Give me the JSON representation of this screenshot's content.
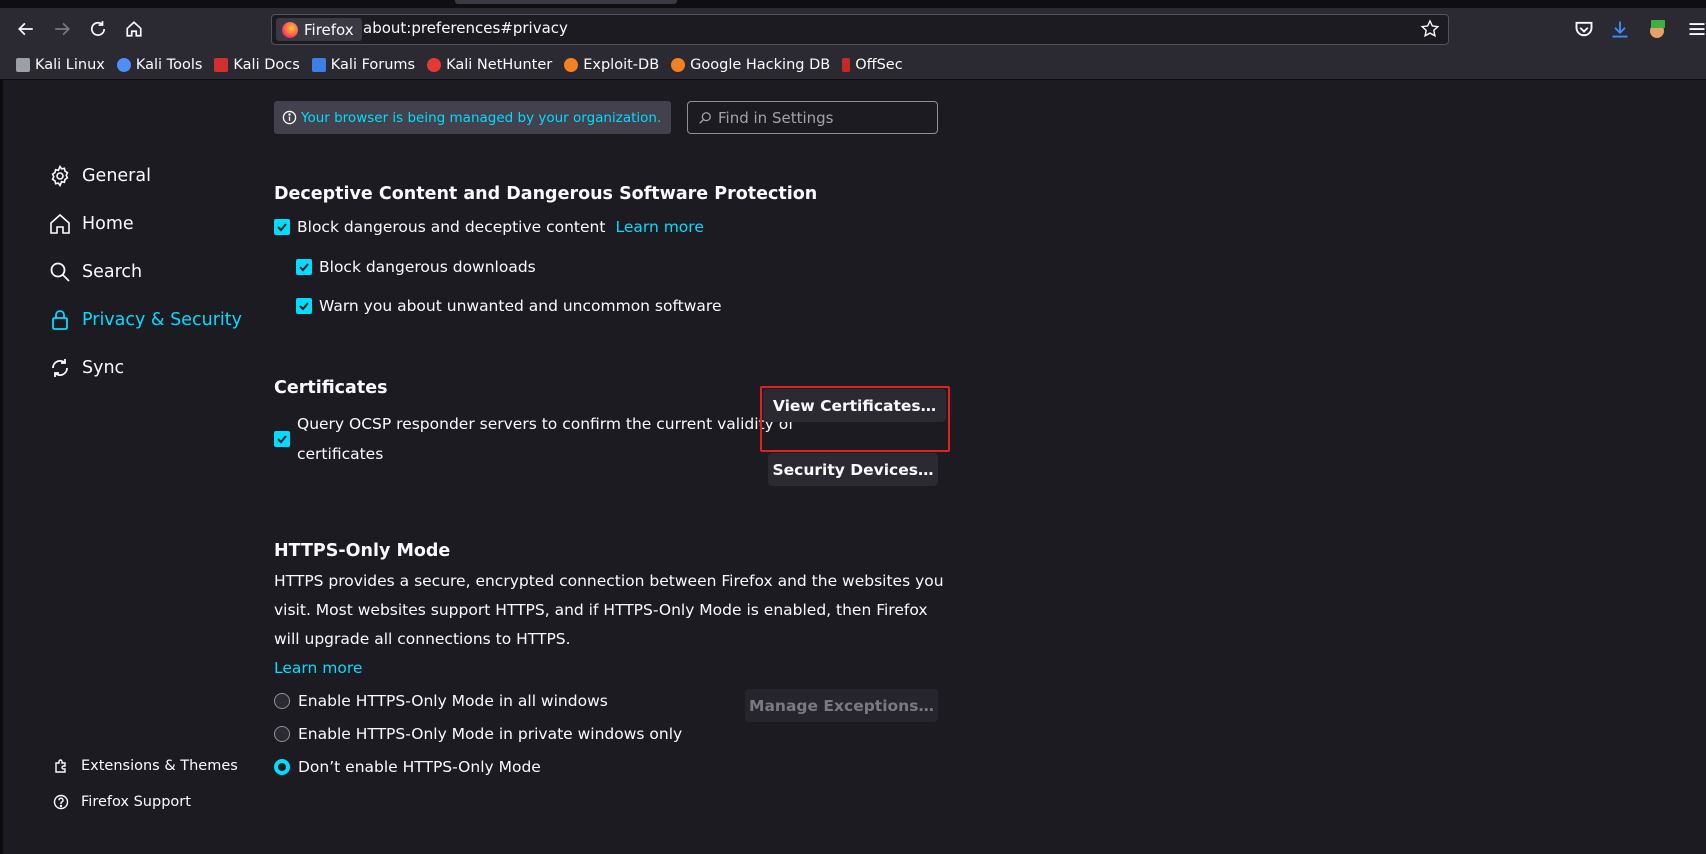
{
  "browser": {
    "identity_label": "Firefox",
    "url": "about:preferences#privacy"
  },
  "bookmarks": [
    {
      "label": "Kali Linux",
      "icon": "kali-dragon-icon",
      "color": "#9aa0a6"
    },
    {
      "label": "Kali Tools",
      "icon": "kali-tools-icon",
      "color": "#4f8ef7"
    },
    {
      "label": "Kali Docs",
      "icon": "kali-docs-icon",
      "color": "#d32f2f"
    },
    {
      "label": "Kali Forums",
      "icon": "kali-forums-icon",
      "color": "#3d7fe6"
    },
    {
      "label": "Kali NetHunter",
      "icon": "nethunter-icon",
      "color": "#e53935"
    },
    {
      "label": "Exploit-DB",
      "icon": "exploit-db-icon",
      "color": "#f4801f"
    },
    {
      "label": "Google Hacking DB",
      "icon": "ghdb-icon",
      "color": "#f4801f"
    },
    {
      "label": "OffSec",
      "icon": "offsec-icon",
      "color": "#c62828"
    }
  ],
  "sidebar": {
    "categories": [
      {
        "label": "General",
        "icon": "gear-icon"
      },
      {
        "label": "Home",
        "icon": "home-icon"
      },
      {
        "label": "Search",
        "icon": "search-icon"
      },
      {
        "label": "Privacy & Security",
        "icon": "lock-icon",
        "selected": true
      },
      {
        "label": "Sync",
        "icon": "sync-icon"
      }
    ],
    "footer": [
      {
        "label": "Extensions & Themes",
        "icon": "puzzle-icon"
      },
      {
        "label": "Firefox Support",
        "icon": "help-icon"
      }
    ]
  },
  "managed_notice": "Your browser is being managed by your organization.",
  "search": {
    "placeholder": "Find in Settings"
  },
  "deceptive": {
    "heading": "Deceptive Content and Dangerous Software Protection",
    "block_content": "Block dangerous and deceptive content",
    "learn_more": "Learn more",
    "block_downloads": "Block dangerous downloads",
    "warn_software": "Warn you about unwanted and uncommon software"
  },
  "certificates": {
    "heading": "Certificates",
    "ocsp_line1": "Query OCSP responder servers to confirm the current validity of",
    "ocsp_line2": "certificates",
    "view_button": "View Certificates…",
    "devices_button": "Security Devices…"
  },
  "https_only": {
    "heading": "HTTPS-Only Mode",
    "description": "HTTPS provides a secure, encrypted connection between Firefox and the websites you visit. Most websites support HTTPS, and if HTTPS-Only Mode is enabled, then Firefox will upgrade all connections to HTTPS.",
    "learn_more": "Learn more",
    "options": [
      {
        "label": "Enable HTTPS-Only Mode in all windows",
        "selected": false
      },
      {
        "label": "Enable HTTPS-Only Mode in private windows only",
        "selected": false
      },
      {
        "label": "Don’t enable HTTPS-Only Mode",
        "selected": true
      }
    ],
    "exceptions_button": "Manage Exceptions…"
  },
  "colors": {
    "accent": "#00ddff",
    "highlight_box": "#e22020",
    "background": "#1c1b22",
    "toolbar": "#2b2a33"
  }
}
